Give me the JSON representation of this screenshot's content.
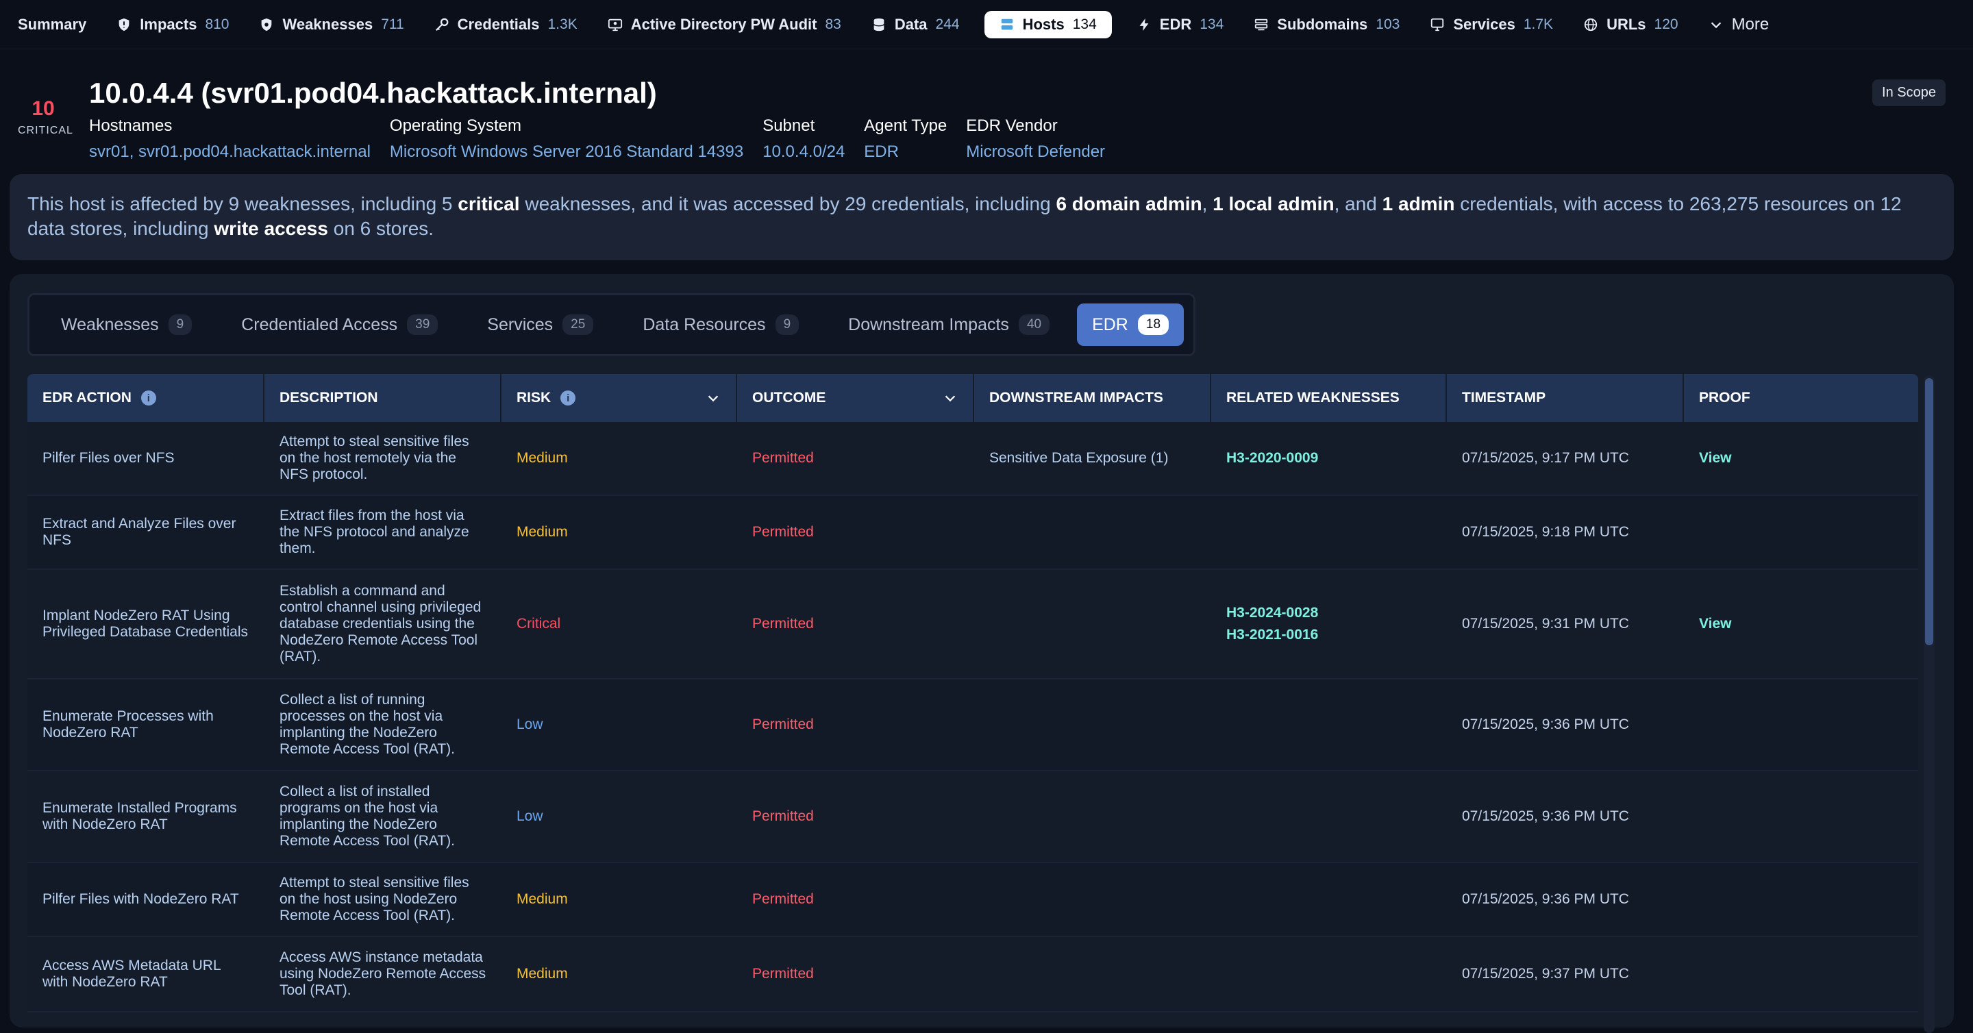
{
  "nav": {
    "items": [
      {
        "label": "Summary",
        "count": "",
        "icon": "none"
      },
      {
        "label": "Impacts",
        "count": "810",
        "icon": "shield-icon"
      },
      {
        "label": "Weaknesses",
        "count": "711",
        "icon": "shield-icon"
      },
      {
        "label": "Credentials",
        "count": "1.3K",
        "icon": "key-icon"
      },
      {
        "label": "Active Directory PW Audit",
        "count": "83",
        "icon": "ad-audit-icon"
      },
      {
        "label": "Data",
        "count": "244",
        "icon": "database-icon"
      },
      {
        "label": "Hosts",
        "count": "134",
        "icon": "host-icon"
      },
      {
        "label": "EDR",
        "count": "134",
        "icon": "bolt-icon"
      },
      {
        "label": "Subdomains",
        "count": "103",
        "icon": "subdomain-icon"
      },
      {
        "label": "Services",
        "count": "1.7K",
        "icon": "monitor-icon"
      },
      {
        "label": "URLs",
        "count": "120",
        "icon": "globe-icon"
      }
    ],
    "more_label": "More",
    "active": "Hosts"
  },
  "host": {
    "score": "10",
    "score_label": "CRITICAL",
    "title": "10.0.4.4 (svr01.pod04.hackattack.internal)",
    "scope": "In Scope",
    "meta": [
      {
        "key": "Hostnames",
        "value": "svr01, svr01.pod04.hackattack.internal"
      },
      {
        "key": "Operating System",
        "value": "Microsoft Windows Server 2016 Standard 14393"
      },
      {
        "key": "Subnet",
        "value": "10.0.4.0/24"
      },
      {
        "key": "Agent Type",
        "value": "EDR"
      },
      {
        "key": "EDR Vendor",
        "value": "Microsoft Defender"
      }
    ]
  },
  "summary": {
    "p1": "This host is affected by 9 weaknesses, including 5 ",
    "b1": "critical",
    "p2": " weaknesses, and it was accessed by 29 credentials, including ",
    "b2": "6 domain admin",
    "p3": ", ",
    "b3": "1 local admin",
    "p4": ", and ",
    "b4": "1 admin",
    "p5": " credentials, with access to 263,275 resources on 12 data stores, including ",
    "b5": "write access",
    "p6": " on 6 stores."
  },
  "tabs": [
    {
      "label": "Weaknesses",
      "count": "9"
    },
    {
      "label": "Credentialed Access",
      "count": "39"
    },
    {
      "label": "Services",
      "count": "25"
    },
    {
      "label": "Data Resources",
      "count": "9"
    },
    {
      "label": "Downstream Impacts",
      "count": "40"
    },
    {
      "label": "EDR",
      "count": "18"
    }
  ],
  "table": {
    "headers": [
      "EDR ACTION",
      "DESCRIPTION",
      "RISK",
      "OUTCOME",
      "DOWNSTREAM IMPACTS",
      "RELATED WEAKNESSES",
      "TIMESTAMP",
      "PROOF"
    ],
    "rows": [
      {
        "action": "Pilfer Files over NFS",
        "description": "Attempt to steal sensitive files on the host remotely via the NFS protocol.",
        "risk": "Medium",
        "outcome": "Permitted",
        "impacts": "Sensitive Data Exposure (1)",
        "weaknesses": [
          "H3-2020-0009"
        ],
        "timestamp": "07/15/2025, 9:17 PM UTC",
        "proof": "View"
      },
      {
        "action": "Extract and Analyze Files over NFS",
        "description": "Extract files from the host via the NFS protocol and analyze them.",
        "risk": "Medium",
        "outcome": "Permitted",
        "impacts": "",
        "weaknesses": [],
        "timestamp": "07/15/2025, 9:18 PM UTC",
        "proof": ""
      },
      {
        "action": "Implant NodeZero RAT Using Privileged Database Credentials",
        "description": "Establish a command and control channel using privileged database credentials using the NodeZero Remote Access Tool (RAT).",
        "risk": "Critical",
        "outcome": "Permitted",
        "impacts": "",
        "weaknesses": [
          "H3-2024-0028",
          "H3-2021-0016"
        ],
        "timestamp": "07/15/2025, 9:31 PM UTC",
        "proof": "View"
      },
      {
        "action": "Enumerate Processes with NodeZero RAT",
        "description": "Collect a list of running processes on the host via implanting the NodeZero Remote Access Tool (RAT).",
        "risk": "Low",
        "outcome": "Permitted",
        "impacts": "",
        "weaknesses": [],
        "timestamp": "07/15/2025, 9:36 PM UTC",
        "proof": ""
      },
      {
        "action": "Enumerate Installed Programs with NodeZero RAT",
        "description": "Collect a list of installed programs on the host via implanting the NodeZero Remote Access Tool (RAT).",
        "risk": "Low",
        "outcome": "Permitted",
        "impacts": "",
        "weaknesses": [],
        "timestamp": "07/15/2025, 9:36 PM UTC",
        "proof": ""
      },
      {
        "action": "Pilfer Files with NodeZero RAT",
        "description": "Attempt to steal sensitive files on the host using NodeZero Remote Access Tool (RAT).",
        "risk": "Medium",
        "outcome": "Permitted",
        "impacts": "",
        "weaknesses": [],
        "timestamp": "07/15/2025, 9:36 PM UTC",
        "proof": ""
      },
      {
        "action": "Access AWS Metadata URL with NodeZero RAT",
        "description": "Access AWS instance metadata using NodeZero Remote Access Tool (RAT).",
        "risk": "Medium",
        "outcome": "Permitted",
        "impacts": "",
        "weaknesses": [],
        "timestamp": "07/15/2025, 9:37 PM UTC",
        "proof": ""
      }
    ]
  },
  "colors": {
    "critical": "#ff4d5e",
    "medium": "#f5c13b",
    "low": "#6aa7ee",
    "accent_teal": "#7ff0e0",
    "active_tab": "#4b74c9"
  }
}
